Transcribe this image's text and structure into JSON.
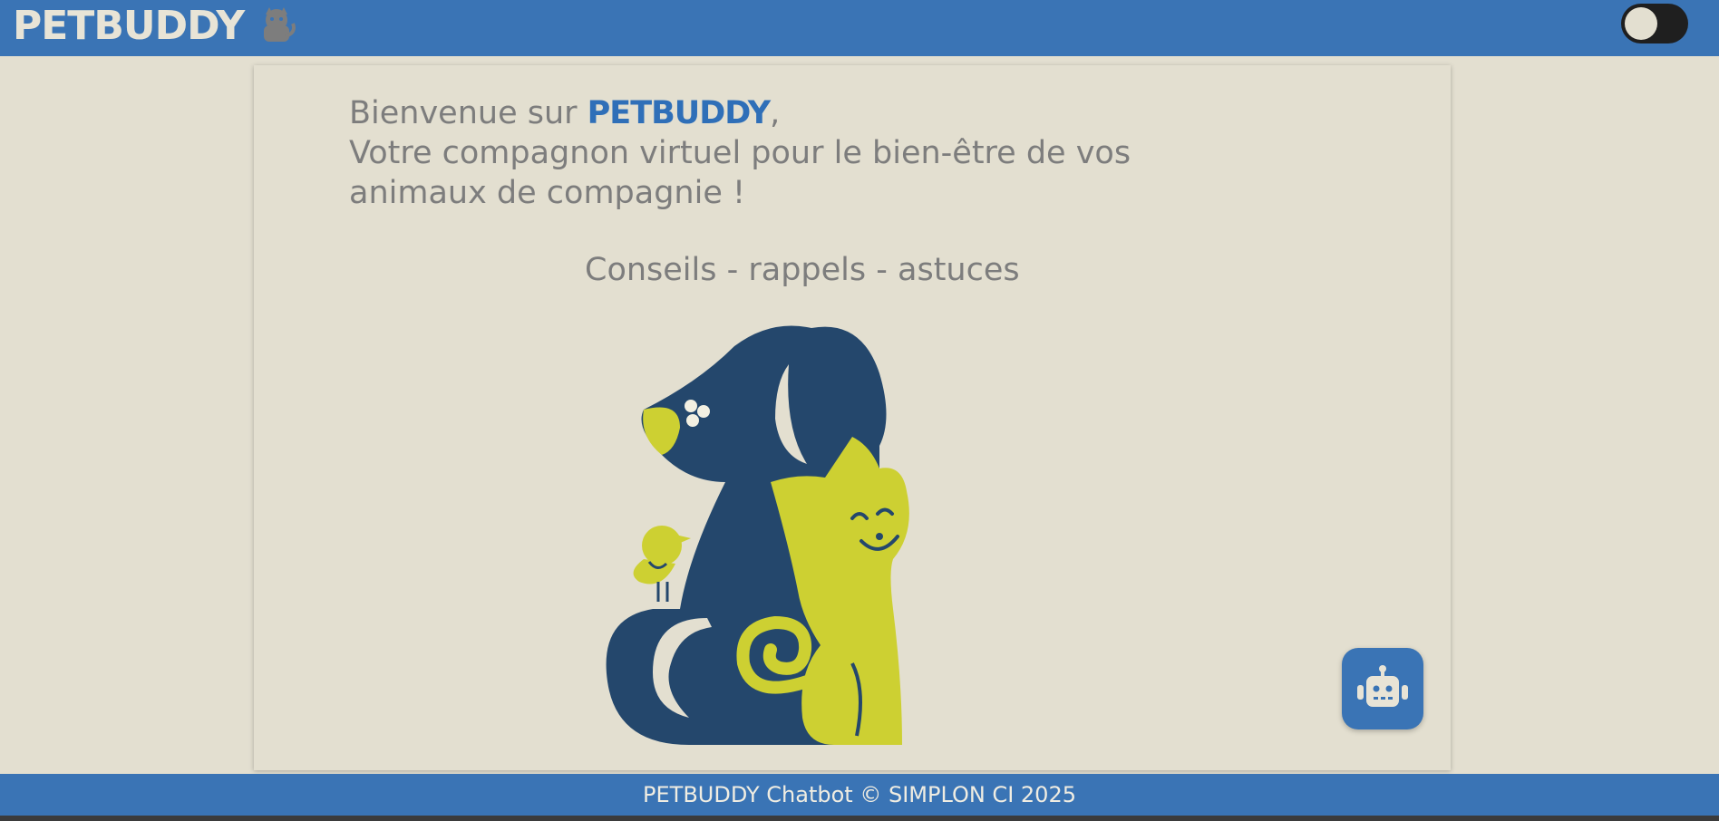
{
  "header": {
    "brand": "PETBUDDY",
    "brand_icon": "cat-icon",
    "theme_toggle": "toggle-switch"
  },
  "main": {
    "welcome_prefix": "Bienvenue sur ",
    "welcome_brand": "PETBUDDY",
    "welcome_suffix": ",",
    "welcome_line2": "Votre compagnon virtuel pour le bien-être de vos animaux de compagnie !",
    "tagline": "Conseils - rappels - astuces",
    "illustration": "dog-cat-bird-illustration",
    "chatbot_button_icon": "robot-icon"
  },
  "footer": {
    "text": "PETBUDDY Chatbot © SIMPLON CI 2025"
  },
  "colors": {
    "header_bg": "#3a74b5",
    "page_bg": "#e3dfd0",
    "brand_accent": "#2f6fb8",
    "dog_navy": "#24476c",
    "lime": "#cdd032"
  }
}
